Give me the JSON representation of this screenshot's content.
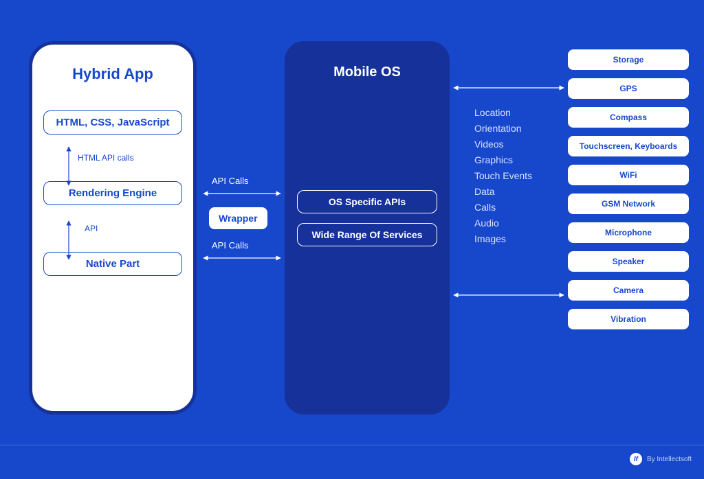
{
  "phone": {
    "title": "Hybrid App",
    "tech": "HTML, CSS, JavaScript",
    "html_api": "HTML API calls",
    "rendering": "Rendering Engine",
    "api": "API",
    "native": "Native Part"
  },
  "wrapper": "Wrapper",
  "api_calls_top": "API Calls",
  "api_calls_bottom": "API Calls",
  "os": {
    "title": "Mobile OS",
    "specific": "OS Specific APIs",
    "services": "Wide Range Of Services"
  },
  "services": [
    "Location",
    "Orientation",
    "Videos",
    "Graphics",
    "Touch Events",
    "Data",
    "Calls",
    "Audio",
    "Images"
  ],
  "hardware": [
    "Storage",
    "GPS",
    "Compass",
    "Touchscreen, Keyboards",
    "WiFi",
    "GSM Network",
    "Microphone",
    "Speaker",
    "Camera",
    "Vibration"
  ],
  "footer": "By Intellectsoft"
}
